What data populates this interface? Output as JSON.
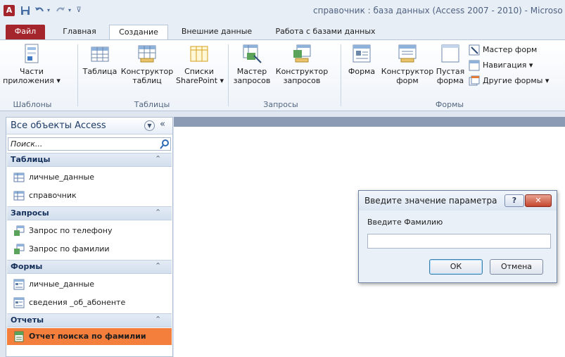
{
  "window": {
    "title": "справочник : база данных (Access 2007 - 2010)  -  Microso",
    "app_letter": "A"
  },
  "quick_access": [
    "save-icon",
    "undo-icon",
    "redo-icon",
    "customize-qat-icon"
  ],
  "tabs": [
    {
      "label": "Файл"
    },
    {
      "label": "Главная"
    },
    {
      "label": "Создание"
    },
    {
      "label": "Внешние данные"
    },
    {
      "label": "Работа с базами данных"
    }
  ],
  "ribbon": {
    "templates": {
      "parts_line1": "Части",
      "parts_line2": "приложения ▾",
      "group_label": "Шаблоны"
    },
    "tables": {
      "table": "Таблица",
      "designer_line1": "Конструктор",
      "designer_line2": "таблиц",
      "sharepoint_line1": "Списки",
      "sharepoint_line2": "SharePoint ▾",
      "group_label": "Таблицы"
    },
    "queries": {
      "wizard_line1": "Мастер",
      "wizard_line2": "запросов",
      "designer_line1": "Конструктор",
      "designer_line2": "запросов",
      "group_label": "Запросы"
    },
    "forms": {
      "form": "Форма",
      "designer_line1": "Конструктор",
      "designer_line2": "форм",
      "blank_line1": "Пустая",
      "blank_line2": "форма",
      "wizard": "Мастер форм",
      "navigation": "Навигация ▾",
      "other": "Другие формы ▾",
      "group_label": "Формы"
    }
  },
  "nav_pane": {
    "title": "Все объекты Access",
    "search_placeholder": "Поиск...",
    "sections": [
      {
        "title": "Таблицы",
        "items": [
          "личные_данные",
          "справочник"
        ]
      },
      {
        "title": "Запросы",
        "items": [
          "Запрос по телефону",
          "Запрос по фамилии"
        ]
      },
      {
        "title": "Формы",
        "items": [
          "личные_данные",
          "сведения _об_абоненте"
        ]
      },
      {
        "title": "Отчеты",
        "items": [
          "Отчет поиска по фамилии"
        ]
      }
    ]
  },
  "dialog": {
    "title": "Введите значение параметра",
    "help_label": "?",
    "close_label": "✕",
    "prompt": "Введите Фамилию",
    "input_value": "",
    "ok_label": "ОК",
    "cancel_label": "Отмена"
  },
  "colors": {
    "file_tab": "#a4262c",
    "selected_report": "#f47f3c",
    "workspace_band": "#8a9bb3",
    "close_button": "#c4452d"
  }
}
